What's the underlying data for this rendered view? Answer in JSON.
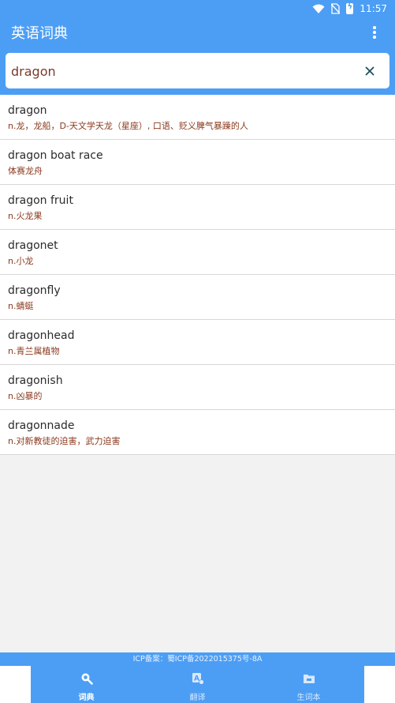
{
  "status_bar": {
    "time": "11:57"
  },
  "app_bar": {
    "title": "英语词典"
  },
  "search": {
    "value": "dragon"
  },
  "results": [
    {
      "word": "dragon",
      "definition": "n.龙，龙船，D-天文学天龙（星座）, 口语、贬义脾气暴躁的人"
    },
    {
      "word": "dragon boat race",
      "definition": "体赛龙舟"
    },
    {
      "word": "dragon fruit",
      "definition": "n.火龙果"
    },
    {
      "word": "dragonet",
      "definition": "n.小龙"
    },
    {
      "word": "dragonfly",
      "definition": "n.蜻蜓"
    },
    {
      "word": "dragonhead",
      "definition": "n.青兰属植物"
    },
    {
      "word": "dragonish",
      "definition": "n.凶暴的"
    },
    {
      "word": "dragonnade",
      "definition": "n.对新教徒的迫害，武力迫害"
    }
  ],
  "footer": {
    "icp": "ICP备案：蜀ICP备2022015375号-8A"
  },
  "bottom_nav": [
    {
      "label": "词典",
      "icon": "search-icon",
      "active": true
    },
    {
      "label": "翻译",
      "icon": "translate-icon",
      "active": false
    },
    {
      "label": "生词本",
      "icon": "folder-icon",
      "active": false
    }
  ],
  "colors": {
    "primary": "#4c9ef5",
    "definition_text": "#8b3a1e",
    "background": "#f2f2f2"
  }
}
